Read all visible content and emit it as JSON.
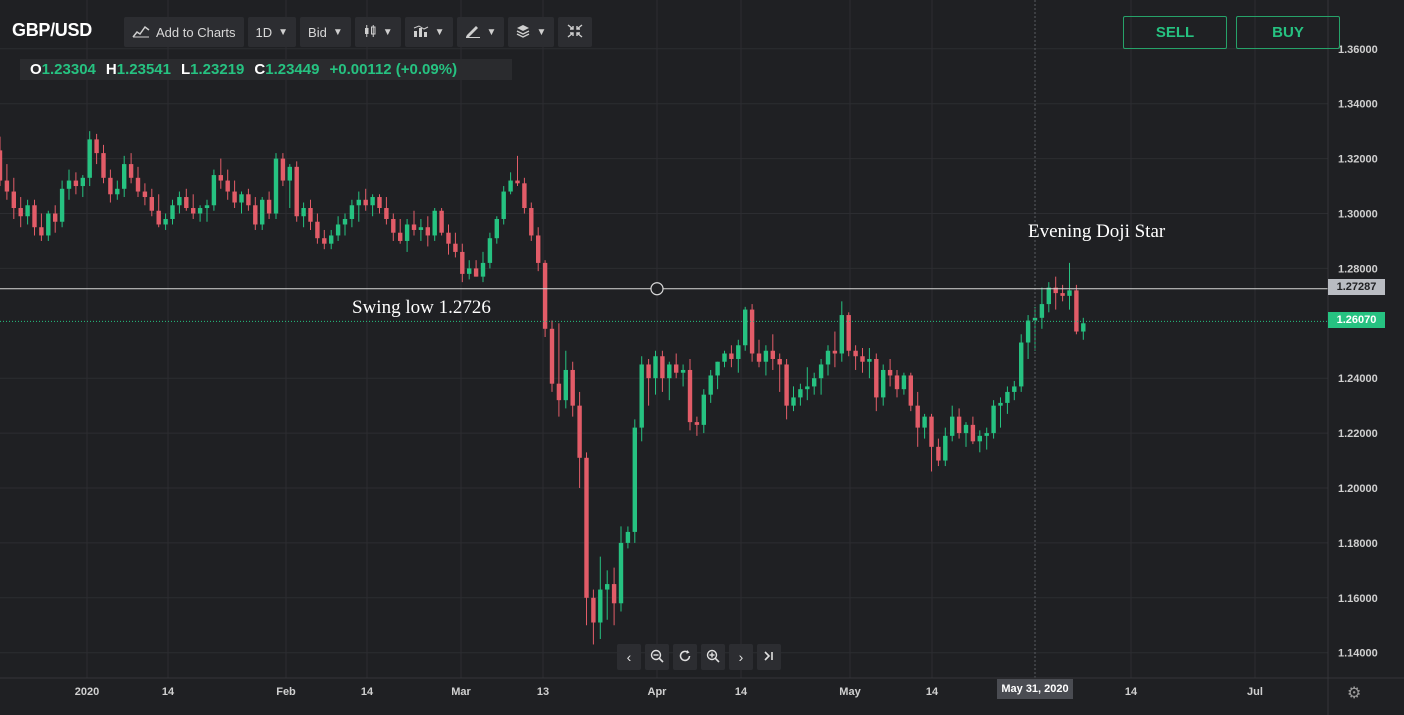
{
  "header": {
    "symbol": "GBP/USD",
    "toolbar": [
      {
        "id": "add",
        "label": "Add to Charts",
        "icon": "chart-add-icon",
        "caret": false
      },
      {
        "id": "interval",
        "label": "1D",
        "caret": true
      },
      {
        "id": "price-type",
        "label": "Bid",
        "caret": true
      },
      {
        "id": "chart-type",
        "label": "",
        "icon": "candles-icon",
        "caret": true
      },
      {
        "id": "indicators",
        "label": "",
        "icon": "indicators-icon",
        "caret": true
      },
      {
        "id": "drawing",
        "label": "",
        "icon": "pencil-icon",
        "caret": true
      },
      {
        "id": "layers",
        "label": "",
        "icon": "layers-icon",
        "caret": true
      },
      {
        "id": "fullscreen",
        "label": "",
        "icon": "collapse-icon",
        "caret": false
      }
    ],
    "ohlc": {
      "o_label": "O",
      "o": "1.23304",
      "h_label": "H",
      "h": "1.23541",
      "l_label": "L",
      "l": "1.23219",
      "c_label": "C",
      "c": "1.23449",
      "change": "+0.00112 (+0.09%)"
    },
    "sell_label": "SELL",
    "buy_label": "BUY"
  },
  "annotations": {
    "swing_low": "Swing low 1.2726",
    "evening_doji": "Evening Doji Star"
  },
  "nav_icons": [
    "chevron-left-icon",
    "zoom-out-icon",
    "refresh-icon",
    "zoom-in-icon",
    "chevron-right-icon",
    "jump-end-icon"
  ],
  "colors": {
    "background": "#1f2023",
    "up": "#26c281",
    "down": "#e25c68",
    "grid": "#2c2d31",
    "axis_text": "#d0d0d0",
    "horizontal_line": "#d8d8d8",
    "price_line": "#26c281",
    "price_tag_gray": "#b9bcc2"
  },
  "chart_data": {
    "type": "candlestick",
    "y_ticks": [
      "1.36000",
      "1.34000",
      "1.32000",
      "1.30000",
      "1.28000",
      "1.24000",
      "1.22000",
      "1.20000",
      "1.18000",
      "1.16000",
      "1.14000"
    ],
    "ylim": [
      1.13,
      1.365
    ],
    "x_ticks": [
      "2020",
      "14",
      "Feb",
      "14",
      "Mar",
      "13",
      "Apr",
      "14",
      "May",
      "14",
      "14",
      "Jul"
    ],
    "horizontal_line": 1.2726,
    "horizontal_line_tag": "1.27287",
    "price_line": 1.2607,
    "price_line_tag": "1.26070",
    "crosshair_date": "May 31, 2020",
    "ohlc": [
      [
        1.323,
        1.328,
        1.31,
        1.312
      ],
      [
        1.312,
        1.318,
        1.305,
        1.308
      ],
      [
        1.308,
        1.313,
        1.298,
        1.302
      ],
      [
        1.302,
        1.306,
        1.295,
        1.299
      ],
      [
        1.299,
        1.305,
        1.296,
        1.303
      ],
      [
        1.303,
        1.305,
        1.292,
        1.295
      ],
      [
        1.295,
        1.3,
        1.29,
        1.292
      ],
      [
        1.292,
        1.301,
        1.29,
        1.3
      ],
      [
        1.3,
        1.303,
        1.293,
        1.297
      ],
      [
        1.297,
        1.312,
        1.295,
        1.309
      ],
      [
        1.309,
        1.316,
        1.305,
        1.312
      ],
      [
        1.312,
        1.315,
        1.307,
        1.31
      ],
      [
        1.31,
        1.314,
        1.306,
        1.313
      ],
      [
        1.313,
        1.33,
        1.31,
        1.327
      ],
      [
        1.327,
        1.329,
        1.318,
        1.322
      ],
      [
        1.322,
        1.325,
        1.311,
        1.313
      ],
      [
        1.313,
        1.316,
        1.304,
        1.307
      ],
      [
        1.307,
        1.312,
        1.305,
        1.309
      ],
      [
        1.309,
        1.321,
        1.306,
        1.318
      ],
      [
        1.318,
        1.322,
        1.311,
        1.313
      ],
      [
        1.313,
        1.317,
        1.306,
        1.308
      ],
      [
        1.308,
        1.311,
        1.303,
        1.306
      ],
      [
        1.306,
        1.309,
        1.299,
        1.301
      ],
      [
        1.301,
        1.307,
        1.295,
        1.296
      ],
      [
        1.296,
        1.3,
        1.294,
        1.298
      ],
      [
        1.298,
        1.305,
        1.296,
        1.303
      ],
      [
        1.303,
        1.308,
        1.3,
        1.306
      ],
      [
        1.306,
        1.309,
        1.301,
        1.302
      ],
      [
        1.302,
        1.307,
        1.298,
        1.3
      ],
      [
        1.3,
        1.303,
        1.297,
        1.302
      ],
      [
        1.302,
        1.305,
        1.297,
        1.303
      ],
      [
        1.303,
        1.316,
        1.301,
        1.314
      ],
      [
        1.314,
        1.32,
        1.309,
        1.312
      ],
      [
        1.312,
        1.316,
        1.305,
        1.308
      ],
      [
        1.308,
        1.312,
        1.302,
        1.304
      ],
      [
        1.304,
        1.308,
        1.3,
        1.307
      ],
      [
        1.307,
        1.309,
        1.301,
        1.303
      ],
      [
        1.303,
        1.306,
        1.294,
        1.296
      ],
      [
        1.296,
        1.306,
        1.294,
        1.305
      ],
      [
        1.305,
        1.308,
        1.298,
        1.3
      ],
      [
        1.3,
        1.322,
        1.298,
        1.32
      ],
      [
        1.32,
        1.322,
        1.31,
        1.312
      ],
      [
        1.312,
        1.318,
        1.302,
        1.317
      ],
      [
        1.317,
        1.319,
        1.297,
        1.299
      ],
      [
        1.299,
        1.304,
        1.295,
        1.302
      ],
      [
        1.302,
        1.305,
        1.294,
        1.297
      ],
      [
        1.297,
        1.3,
        1.289,
        1.291
      ],
      [
        1.291,
        1.294,
        1.287,
        1.289
      ],
      [
        1.289,
        1.294,
        1.287,
        1.292
      ],
      [
        1.292,
        1.299,
        1.29,
        1.296
      ],
      [
        1.296,
        1.3,
        1.292,
        1.298
      ],
      [
        1.298,
        1.305,
        1.295,
        1.303
      ],
      [
        1.303,
        1.308,
        1.297,
        1.305
      ],
      [
        1.305,
        1.309,
        1.301,
        1.303
      ],
      [
        1.303,
        1.307,
        1.299,
        1.306
      ],
      [
        1.306,
        1.307,
        1.3,
        1.302
      ],
      [
        1.302,
        1.306,
        1.296,
        1.298
      ],
      [
        1.298,
        1.3,
        1.29,
        1.293
      ],
      [
        1.293,
        1.298,
        1.289,
        1.29
      ],
      [
        1.29,
        1.298,
        1.286,
        1.296
      ],
      [
        1.296,
        1.301,
        1.292,
        1.294
      ],
      [
        1.294,
        1.298,
        1.29,
        1.295
      ],
      [
        1.295,
        1.299,
        1.288,
        1.292
      ],
      [
        1.292,
        1.302,
        1.29,
        1.301
      ],
      [
        1.301,
        1.302,
        1.292,
        1.293
      ],
      [
        1.293,
        1.296,
        1.285,
        1.289
      ],
      [
        1.289,
        1.293,
        1.284,
        1.286
      ],
      [
        1.286,
        1.289,
        1.275,
        1.278
      ],
      [
        1.278,
        1.283,
        1.276,
        1.28
      ],
      [
        1.28,
        1.283,
        1.277,
        1.277
      ],
      [
        1.277,
        1.286,
        1.275,
        1.282
      ],
      [
        1.282,
        1.293,
        1.28,
        1.291
      ],
      [
        1.291,
        1.299,
        1.289,
        1.298
      ],
      [
        1.298,
        1.31,
        1.296,
        1.308
      ],
      [
        1.308,
        1.315,
        1.307,
        1.312
      ],
      [
        1.312,
        1.321,
        1.31,
        1.311
      ],
      [
        1.311,
        1.313,
        1.3,
        1.302
      ],
      [
        1.302,
        1.304,
        1.29,
        1.292
      ],
      [
        1.292,
        1.295,
        1.279,
        1.282
      ],
      [
        1.282,
        1.283,
        1.255,
        1.258
      ],
      [
        1.258,
        1.261,
        1.235,
        1.238
      ],
      [
        1.238,
        1.26,
        1.226,
        1.232
      ],
      [
        1.232,
        1.25,
        1.229,
        1.243
      ],
      [
        1.243,
        1.246,
        1.226,
        1.23
      ],
      [
        1.23,
        1.235,
        1.2,
        1.211
      ],
      [
        1.211,
        1.213,
        1.15,
        1.16
      ],
      [
        1.16,
        1.163,
        1.143,
        1.151
      ],
      [
        1.151,
        1.175,
        1.145,
        1.163
      ],
      [
        1.163,
        1.17,
        1.152,
        1.165
      ],
      [
        1.165,
        1.171,
        1.15,
        1.158
      ],
      [
        1.158,
        1.186,
        1.155,
        1.18
      ],
      [
        1.18,
        1.186,
        1.178,
        1.184
      ],
      [
        1.184,
        1.225,
        1.18,
        1.222
      ],
      [
        1.222,
        1.248,
        1.217,
        1.245
      ],
      [
        1.245,
        1.247,
        1.23,
        1.24
      ],
      [
        1.24,
        1.25,
        1.234,
        1.248
      ],
      [
        1.248,
        1.25,
        1.235,
        1.24
      ],
      [
        1.24,
        1.246,
        1.232,
        1.245
      ],
      [
        1.245,
        1.249,
        1.24,
        1.242
      ],
      [
        1.242,
        1.245,
        1.237,
        1.243
      ],
      [
        1.243,
        1.247,
        1.221,
        1.224
      ],
      [
        1.224,
        1.226,
        1.219,
        1.223
      ],
      [
        1.223,
        1.236,
        1.22,
        1.234
      ],
      [
        1.234,
        1.243,
        1.231,
        1.241
      ],
      [
        1.241,
        1.246,
        1.236,
        1.246
      ],
      [
        1.246,
        1.25,
        1.244,
        1.249
      ],
      [
        1.249,
        1.252,
        1.244,
        1.247
      ],
      [
        1.247,
        1.254,
        1.242,
        1.252
      ],
      [
        1.252,
        1.266,
        1.25,
        1.265
      ],
      [
        1.265,
        1.267,
        1.246,
        1.249
      ],
      [
        1.249,
        1.254,
        1.244,
        1.246
      ],
      [
        1.246,
        1.252,
        1.241,
        1.25
      ],
      [
        1.25,
        1.256,
        1.243,
        1.247
      ],
      [
        1.247,
        1.249,
        1.235,
        1.245
      ],
      [
        1.245,
        1.247,
        1.225,
        1.23
      ],
      [
        1.23,
        1.237,
        1.228,
        1.233
      ],
      [
        1.233,
        1.238,
        1.23,
        1.236
      ],
      [
        1.236,
        1.244,
        1.232,
        1.237
      ],
      [
        1.237,
        1.242,
        1.234,
        1.24
      ],
      [
        1.24,
        1.247,
        1.234,
        1.245
      ],
      [
        1.245,
        1.252,
        1.241,
        1.25
      ],
      [
        1.25,
        1.257,
        1.244,
        1.249
      ],
      [
        1.249,
        1.268,
        1.246,
        1.263
      ],
      [
        1.263,
        1.264,
        1.248,
        1.25
      ],
      [
        1.25,
        1.252,
        1.243,
        1.248
      ],
      [
        1.248,
        1.251,
        1.242,
        1.246
      ],
      [
        1.246,
        1.251,
        1.24,
        1.247
      ],
      [
        1.247,
        1.249,
        1.228,
        1.233
      ],
      [
        1.233,
        1.245,
        1.23,
        1.243
      ],
      [
        1.243,
        1.247,
        1.237,
        1.241
      ],
      [
        1.241,
        1.243,
        1.233,
        1.236
      ],
      [
        1.236,
        1.242,
        1.234,
        1.241
      ],
      [
        1.241,
        1.242,
        1.228,
        1.23
      ],
      [
        1.23,
        1.235,
        1.215,
        1.222
      ],
      [
        1.222,
        1.227,
        1.218,
        1.226
      ],
      [
        1.226,
        1.227,
        1.206,
        1.215
      ],
      [
        1.215,
        1.218,
        1.208,
        1.21
      ],
      [
        1.21,
        1.222,
        1.208,
        1.219
      ],
      [
        1.219,
        1.23,
        1.217,
        1.226
      ],
      [
        1.226,
        1.229,
        1.218,
        1.22
      ],
      [
        1.22,
        1.224,
        1.215,
        1.223
      ],
      [
        1.223,
        1.226,
        1.216,
        1.217
      ],
      [
        1.217,
        1.221,
        1.213,
        1.219
      ],
      [
        1.219,
        1.222,
        1.214,
        1.22
      ],
      [
        1.22,
        1.232,
        1.218,
        1.23
      ],
      [
        1.23,
        1.233,
        1.222,
        1.231
      ],
      [
        1.231,
        1.237,
        1.227,
        1.235
      ],
      [
        1.235,
        1.239,
        1.232,
        1.237
      ],
      [
        1.237,
        1.256,
        1.235,
        1.253
      ],
      [
        1.253,
        1.263,
        1.247,
        1.261
      ],
      [
        1.261,
        1.266,
        1.25,
        1.262
      ],
      [
        1.262,
        1.273,
        1.258,
        1.267
      ],
      [
        1.267,
        1.275,
        1.264,
        1.273
      ],
      [
        1.273,
        1.277,
        1.265,
        1.271
      ],
      [
        1.271,
        1.274,
        1.268,
        1.27
      ],
      [
        1.27,
        1.282,
        1.265,
        1.272
      ],
      [
        1.272,
        1.274,
        1.256,
        1.257
      ],
      [
        1.257,
        1.262,
        1.254,
        1.26
      ]
    ]
  }
}
